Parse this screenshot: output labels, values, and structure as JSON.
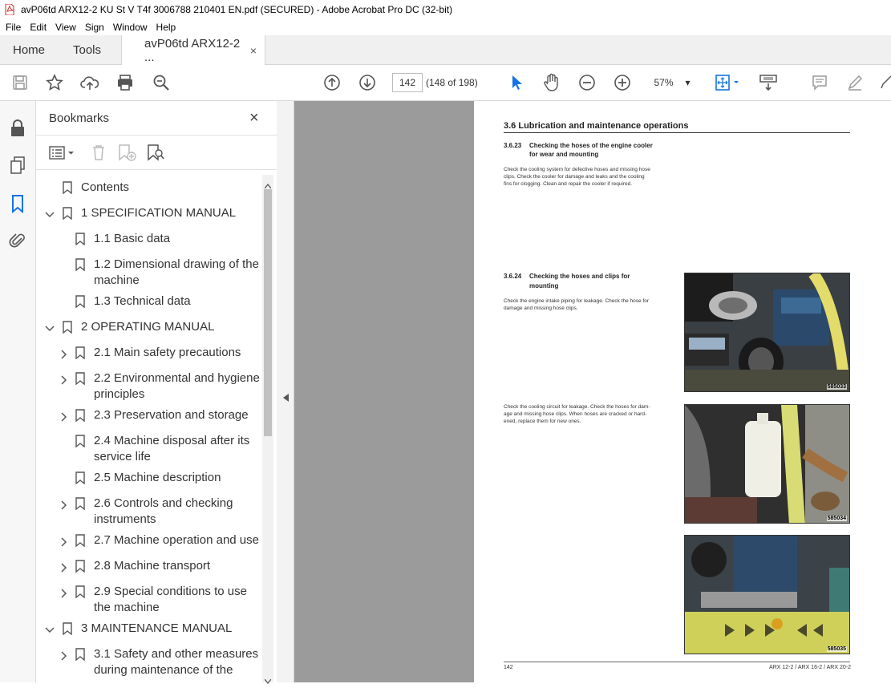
{
  "window": {
    "title": "avP06td ARX12-2 KU St V T4f 3006788 210401 EN.pdf (SECURED) - Adobe Acrobat Pro DC (32-bit)"
  },
  "menu": [
    "File",
    "Edit",
    "View",
    "Sign",
    "Window",
    "Help"
  ],
  "tabs": {
    "home": "Home",
    "tools": "Tools",
    "doc": "avP06td ARX12-2 ...",
    "close": "×"
  },
  "toolbar": {
    "page_current": "142",
    "page_of": "(148 of 198)",
    "zoom": "57%",
    "zoom_caret": "▾"
  },
  "bookmarks": {
    "header": "Bookmarks",
    "close": "×",
    "items": [
      {
        "label": "Contents",
        "level": 0,
        "expand": "none"
      },
      {
        "label": "1 SPECIFICATION MANUAL",
        "level": 0,
        "expand": "open"
      },
      {
        "label": "1.1 Basic data",
        "level": 1,
        "expand": "none"
      },
      {
        "label": "1.2 Dimensional drawing of the",
        "label2": "machine",
        "level": 1,
        "expand": "none"
      },
      {
        "label": "1.3 Technical data",
        "level": 1,
        "expand": "none"
      },
      {
        "label": "2 OPERATING MANUAL",
        "level": 0,
        "expand": "open"
      },
      {
        "label": "2.1 Main safety precautions",
        "level": 1,
        "expand": "closed"
      },
      {
        "label": "2.2 Environmental and hygiene",
        "label2": "principles",
        "level": 1,
        "expand": "closed"
      },
      {
        "label": "2.3 Preservation and storage",
        "level": 1,
        "expand": "closed"
      },
      {
        "label": "2.4 Machine disposal after its",
        "label2": "service life",
        "level": 1,
        "expand": "none"
      },
      {
        "label": "2.5 Machine description",
        "level": 1,
        "expand": "none"
      },
      {
        "label": "2.6 Controls and checking",
        "label2": "instruments",
        "level": 1,
        "expand": "closed"
      },
      {
        "label": "2.7 Machine operation and use",
        "level": 1,
        "expand": "closed"
      },
      {
        "label": "2.8 Machine transport",
        "level": 1,
        "expand": "closed"
      },
      {
        "label": "2.9 Special conditions to use",
        "label2": "the machine",
        "level": 1,
        "expand": "closed"
      },
      {
        "label": "3 MAINTENANCE MANUAL",
        "level": 0,
        "expand": "open"
      },
      {
        "label": "3.1 Safety and other measures",
        "label2": "during maintenance of the",
        "level": 1,
        "expand": "closed"
      }
    ]
  },
  "document": {
    "section": "3.6      Lubrication and maintenance operations",
    "s1_num": "3.6.23",
    "s1_title_1": "Checking the hoses of the engine cooler",
    "s1_title_2": "for wear and mounting",
    "s1_text_1": "Check the cooling system for defective hoses and missing hose",
    "s1_text_2": "clips. Check the cooler for damage and leaks and the cooling",
    "s1_text_3": "fins for clogging. Clean and repair the cooler if required.",
    "s2_num": "3.6.24",
    "s2_title_1": "Checking the hoses and clips for",
    "s2_title_2": "mounting",
    "s2_text_1": "Check the engine intake piping for leakage. Check the hose for",
    "s2_text_2": "damage and missing hose clips.",
    "s3_text_1": "Check the cooling circuit for leakage. Check the hoses for dam-",
    "s3_text_2": "age and missing hose clips. When hoses are cracked or hard-",
    "s3_text_3": "ened, replace them for new ones.",
    "photo1_code": "585033",
    "photo2_code": "585034",
    "photo3_code": "585035",
    "footer_left": "142",
    "footer_right": "ARX 12-2 / ARX 16-2 / ARX 20-2"
  },
  "colors": {
    "accent_blue": "#1473e6",
    "pdf_red": "#d4231f"
  }
}
